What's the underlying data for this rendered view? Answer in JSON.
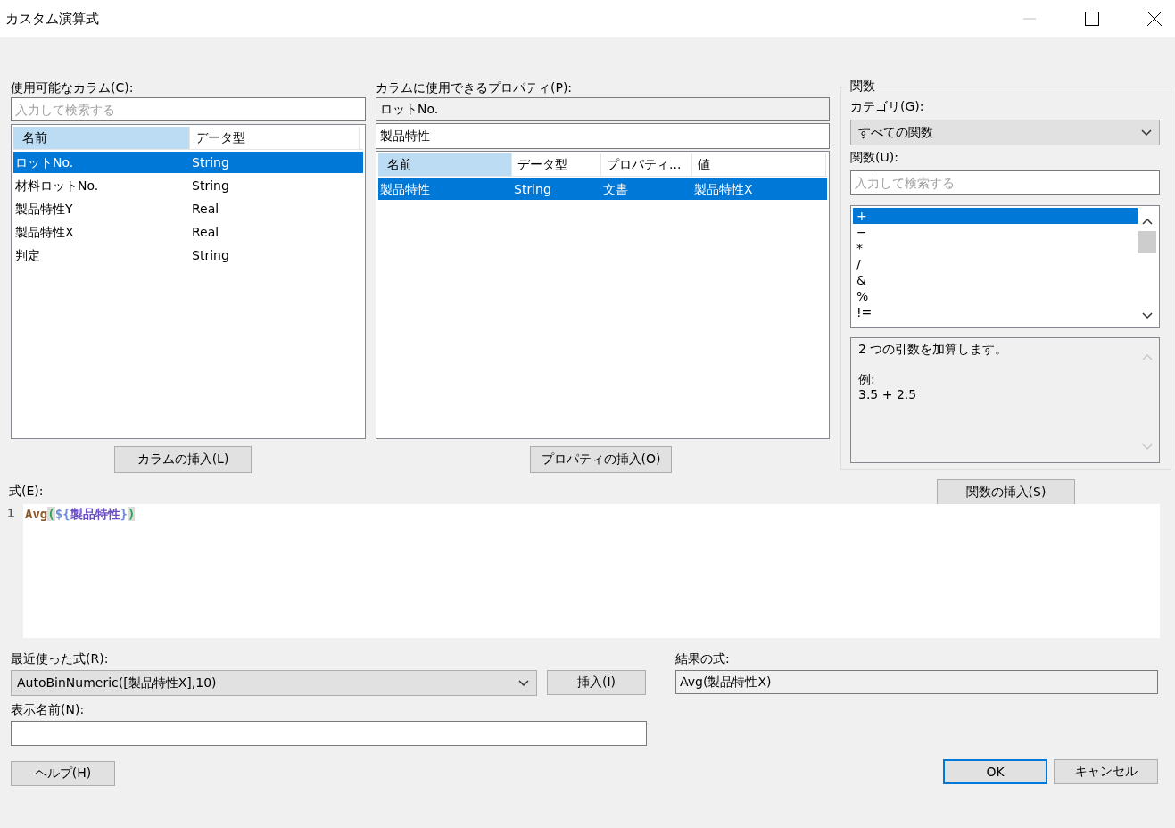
{
  "window": {
    "title": "カスタム演算式",
    "controls": [
      {
        "kind": "minimize",
        "disabled": true
      },
      {
        "kind": "maximize",
        "disabled": false
      },
      {
        "kind": "close",
        "disabled": false
      }
    ]
  },
  "columns_panel": {
    "label": "使用可能なカラム(C):",
    "search": {
      "placeholder": "入力して検索する"
    },
    "headers": [
      {
        "label": "名前",
        "selected": true
      },
      {
        "label": "データ型",
        "selected": false
      }
    ],
    "rows": [
      {
        "cells": [
          "ロットNo.",
          "String"
        ],
        "selected": true
      },
      {
        "cells": [
          "材料ロットNo.",
          "String"
        ],
        "selected": false
      },
      {
        "cells": [
          "製品特性Y",
          "Real"
        ],
        "selected": false
      },
      {
        "cells": [
          "製品特性X",
          "Real"
        ],
        "selected": false
      },
      {
        "cells": [
          "判定",
          "String"
        ],
        "selected": false
      }
    ],
    "insert_button": "カラムの挿入(L)"
  },
  "properties_panel": {
    "label": "カラムに使用できるプロパティ(P):",
    "column_field": {
      "value": "ロットNo."
    },
    "filter_field": {
      "value": "製品特性"
    },
    "headers": [
      {
        "label": "名前",
        "selected": true
      },
      {
        "label": "データ型",
        "selected": false
      },
      {
        "label": "プロパティ...",
        "selected": false
      },
      {
        "label": "値",
        "selected": false
      }
    ],
    "rows": [
      {
        "cells": [
          "製品特性",
          "String",
          "文書",
          "製品特性X"
        ],
        "selected": true
      }
    ],
    "insert_button": "プロパティの挿入(O)"
  },
  "functions_panel": {
    "title": "関数",
    "category_label": "カテゴリ(G):",
    "category": {
      "value": "すべての関数"
    },
    "function_label": "関数(U):",
    "search": {
      "placeholder": "入力して検索する"
    },
    "items": [
      {
        "label": "+",
        "selected": true
      },
      {
        "label": "−",
        "selected": false
      },
      {
        "label": "*",
        "selected": false
      },
      {
        "label": "/",
        "selected": false
      },
      {
        "label": "&",
        "selected": false
      },
      {
        "label": "%",
        "selected": false
      },
      {
        "label": "!=",
        "selected": false
      }
    ],
    "description": "2 つの引数を加算します。",
    "example_label": "例:",
    "example": "3.5 + 2.5",
    "insert_button": "関数の挿入(S)"
  },
  "expression": {
    "label": "式(E):",
    "line_number": "1",
    "tokens": [
      {
        "text": "Avg",
        "kind": "function"
      },
      {
        "text": "(",
        "kind": "bracket"
      },
      {
        "text": "${",
        "kind": "brace"
      },
      {
        "text": "製品特性",
        "kind": "reference"
      },
      {
        "text": "}",
        "kind": "brace"
      },
      {
        "text": ")",
        "kind": "bracket"
      }
    ]
  },
  "recent": {
    "label": "最近使った式(R):",
    "value": "AutoBinNumeric([製品特性X],10)",
    "insert_button": "挿入(I)"
  },
  "result": {
    "label": "結果の式:",
    "value": "Avg(製品特性X)"
  },
  "display_name": {
    "label": "表示名前(N):"
  },
  "buttons": [
    {
      "label": "ヘルプ(H)",
      "default": false
    },
    {
      "label": "OK",
      "default": true
    },
    {
      "label": "キャンセル",
      "default": false
    }
  ]
}
